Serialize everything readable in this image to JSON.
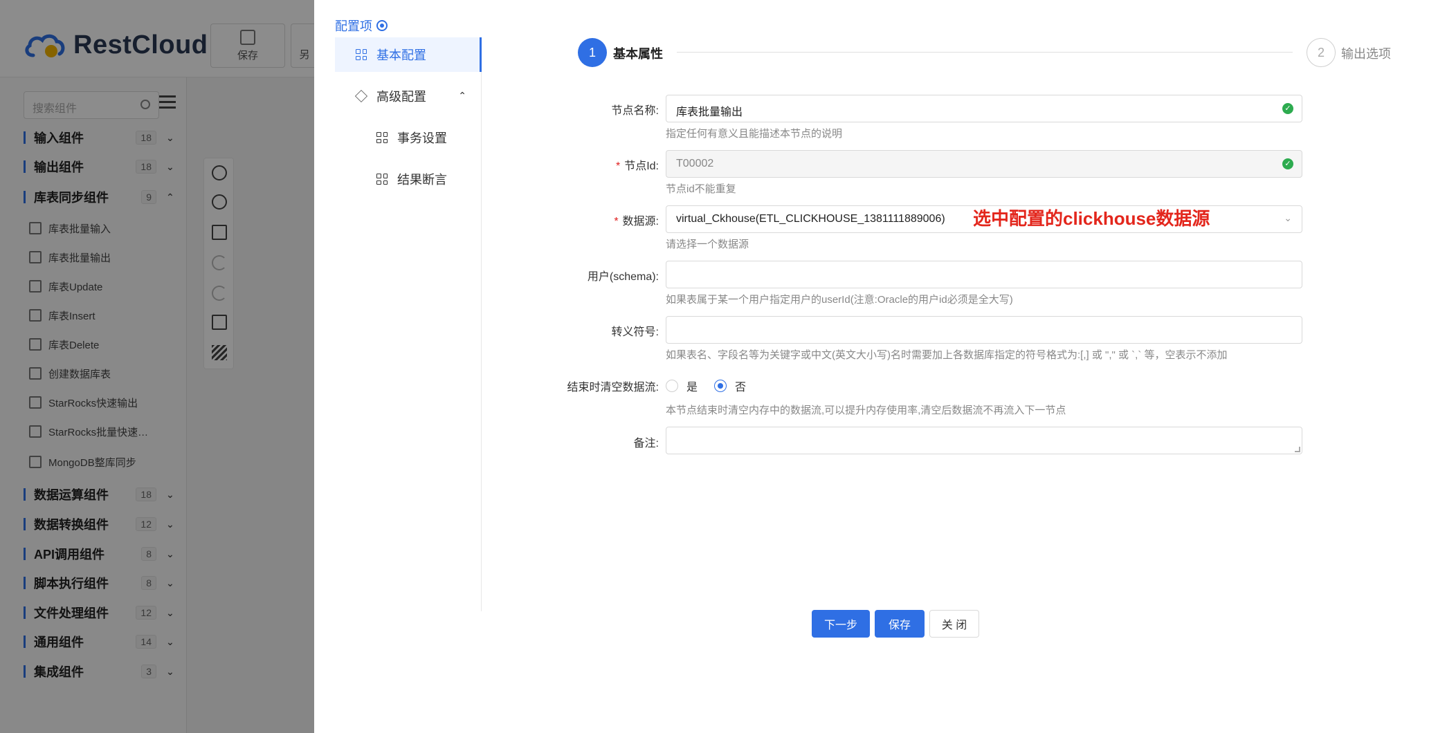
{
  "app": {
    "brand": "RestCloud",
    "toolbar": {
      "save_label": "保存",
      "next_label_partial": "另"
    },
    "search_placeholder": "搜索组件",
    "categories": [
      {
        "label": "输入组件",
        "count": "18",
        "chevron": "⌄"
      },
      {
        "label": "输出组件",
        "count": "18",
        "chevron": "⌄"
      },
      {
        "label": "库表同步组件",
        "count": "9",
        "chevron": "⌃"
      },
      {
        "label": "数据运算组件",
        "count": "18",
        "chevron": "⌄"
      },
      {
        "label": "数据转换组件",
        "count": "12",
        "chevron": "⌄"
      },
      {
        "label": "API调用组件",
        "count": "8",
        "chevron": "⌄"
      },
      {
        "label": "脚本执行组件",
        "count": "8",
        "chevron": "⌄"
      },
      {
        "label": "文件处理组件",
        "count": "12",
        "chevron": "⌄"
      },
      {
        "label": "通用组件",
        "count": "14",
        "chevron": "⌄"
      },
      {
        "label": "集成组件",
        "count": "3",
        "chevron": "⌄"
      }
    ],
    "sync_items": [
      "库表批量输入",
      "库表批量输出",
      "库表Update",
      "库表Insert",
      "库表Delete",
      "创建数据库表",
      "StarRocks快速输出",
      "StarRocks批量快速…",
      "MongoDB整库同步"
    ]
  },
  "drawer": {
    "title": "配置项",
    "nav": {
      "basic": "基本配置",
      "advanced": "高级配置",
      "advanced_chevron": "⌃",
      "transaction": "事务设置",
      "assertion": "结果断言"
    },
    "steps": [
      {
        "num": "1",
        "label": "基本属性"
      },
      {
        "num": "2",
        "label": "输出选项"
      }
    ],
    "form": {
      "node_name": {
        "label": "节点名称:",
        "value": "库表批量输出",
        "help": "指定任何有意义且能描述本节点的说明"
      },
      "node_id": {
        "label": "节点Id:",
        "required": "*",
        "value": "T00002",
        "help": "节点id不能重复"
      },
      "datasource": {
        "label": "数据源:",
        "required": "*",
        "value": "virtual_Ckhouse(ETL_CLICKHOUSE_1381111889006)",
        "help": "请选择一个数据源",
        "arrow": "⌄"
      },
      "schema": {
        "label": "用户(schema):",
        "value": "",
        "help": "如果表属于某一个用户指定用户的userId(注意:Oracle的用户id必须是全大写)"
      },
      "escape": {
        "label": "转义符号:",
        "value": "",
        "help": "如果表名、字段名等为关键字或中文(英文大小写)名时需要加上各数据库指定的符号格式为:[,] 或 \",\" 或 `,` 等，空表示不添加"
      },
      "clear_stream": {
        "label": "结束时清空数据流:",
        "yes": "是",
        "no": "否",
        "selected": "否",
        "help": "本节点结束时清空内存中的数据流,可以提升内存使用率,清空后数据流不再流入下一节点"
      },
      "remark": {
        "label": "备注:",
        "value": ""
      }
    },
    "annotation": "选中配置的clickhouse数据源",
    "buttons": {
      "next": "下一步",
      "save": "保存",
      "close": "关 闭"
    }
  },
  "colors": {
    "primary": "#2f6fe4",
    "success": "#2dab4f",
    "annotation": "#e3261c"
  }
}
